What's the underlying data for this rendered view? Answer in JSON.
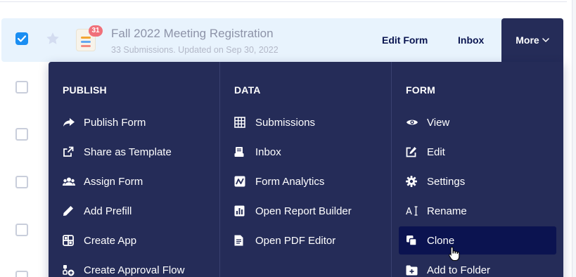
{
  "form_row": {
    "title": "Fall 2022 Meeting Registration",
    "subtitle": "33 Submissions. Updated on Sep 30, 2022",
    "badge_count": "31",
    "selected": true,
    "actions": {
      "edit_form": "Edit Form",
      "inbox": "Inbox",
      "more": "More"
    }
  },
  "menu": {
    "columns": [
      {
        "heading": "PUBLISH",
        "items": [
          {
            "label": "Publish Form",
            "icon": "share-arrow-icon"
          },
          {
            "label": "Share as Template",
            "icon": "share-template-icon"
          },
          {
            "label": "Assign Form",
            "icon": "assign-users-icon"
          },
          {
            "label": "Add Prefill",
            "icon": "pencil-icon"
          },
          {
            "label": "Create App",
            "icon": "app-grid-icon"
          },
          {
            "label": "Create Approval Flow",
            "icon": "approval-flow-icon"
          }
        ]
      },
      {
        "heading": "DATA",
        "items": [
          {
            "label": "Submissions",
            "icon": "table-icon"
          },
          {
            "label": "Inbox",
            "icon": "inbox-icon"
          },
          {
            "label": "Form Analytics",
            "icon": "analytics-icon"
          },
          {
            "label": "Open Report Builder",
            "icon": "report-icon"
          },
          {
            "label": "Open PDF Editor",
            "icon": "pdf-document-icon"
          }
        ]
      },
      {
        "heading": "FORM",
        "items": [
          {
            "label": "View",
            "icon": "eye-icon"
          },
          {
            "label": "Edit",
            "icon": "edit-icon"
          },
          {
            "label": "Settings",
            "icon": "gear-icon"
          },
          {
            "label": "Rename",
            "icon": "rename-icon"
          },
          {
            "label": "Clone",
            "icon": "clone-icon",
            "active": true
          },
          {
            "label": "Add to Folder",
            "icon": "folder-add-icon"
          }
        ]
      }
    ]
  },
  "colors": {
    "menu_bg": "#252c58",
    "menu_active": "#0b1350",
    "row_selected_bg": "#e8f3fd",
    "checkbox_blue": "#1b8ef2",
    "badge_red": "#f0707a",
    "action_text": "#0a1551"
  }
}
